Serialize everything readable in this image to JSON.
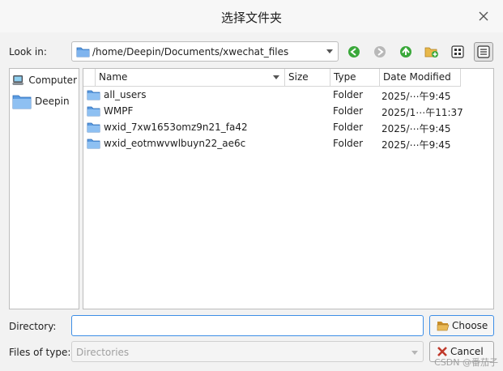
{
  "window": {
    "title": "选择文件夹"
  },
  "lookin": {
    "label": "Look in:",
    "path": "/home/Deepin/Documents/xwechat_files"
  },
  "toolbar": {
    "buttons": [
      {
        "name": "back-button",
        "icon": "green-left-arrow-icon"
      },
      {
        "name": "forward-button",
        "icon": "gray-right-arrow-icon"
      },
      {
        "name": "parent-dir-button",
        "icon": "green-up-arrow-icon"
      },
      {
        "name": "new-folder-button",
        "icon": "new-folder-icon"
      },
      {
        "name": "list-view-button",
        "icon": "list-view-icon"
      },
      {
        "name": "detail-view-button",
        "icon": "detail-view-icon"
      }
    ]
  },
  "sidebar": {
    "items": [
      {
        "label": "Computer",
        "icon": "computer-icon"
      },
      {
        "label": "Deepin",
        "icon": "folder-icon"
      }
    ]
  },
  "table": {
    "columns": [
      "Name",
      "Size",
      "Type",
      "Date Modified"
    ],
    "rows": [
      {
        "name": "all_users",
        "size": "",
        "type": "Folder",
        "date": "2025/⋯午9:45"
      },
      {
        "name": "WMPF",
        "size": "",
        "type": "Folder",
        "date": "2025/1⋯午11:37"
      },
      {
        "name": "wxid_7xw1653omz9n21_fa42",
        "size": "",
        "type": "Folder",
        "date": "2025/⋯午9:45"
      },
      {
        "name": "wxid_eotmwvwlbuyn22_ae6c",
        "size": "",
        "type": "Folder",
        "date": "2025/⋯午9:45"
      }
    ]
  },
  "directory": {
    "label": "Directory:",
    "value": ""
  },
  "filetype": {
    "label": "Files of type:",
    "value": "Directories"
  },
  "buttons": {
    "choose": "Choose",
    "cancel": "Cancel"
  },
  "watermark": "CSDN @番茄子",
  "colors": {
    "accent": "#3d8ee6",
    "folder": "#5b9be0",
    "green": "#3aa83a"
  }
}
